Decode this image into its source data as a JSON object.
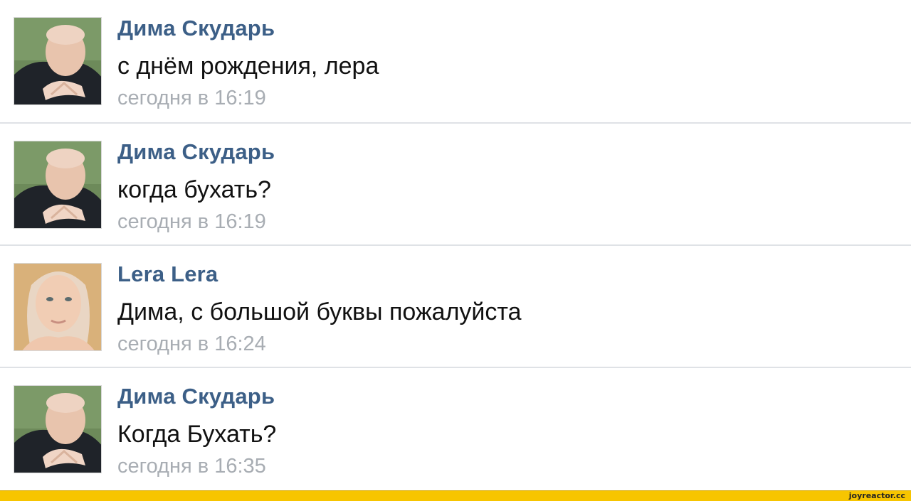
{
  "messages": [
    {
      "author": "Дима Скударь",
      "text": "с днём рождения, лера",
      "time": "сегодня в 16:19",
      "avatar": "dima-avatar"
    },
    {
      "author": "Дима Скударь",
      "text": "когда бухать?",
      "time": "сегодня в 16:19",
      "avatar": "dima-avatar"
    },
    {
      "author": "Lera Lera",
      "text": "Дима, с большой буквы пожалуйста",
      "time": "сегодня в 16:24",
      "avatar": "lera-avatar"
    },
    {
      "author": "Дима Скударь",
      "text": "Когда Бухать?",
      "time": "сегодня в 16:35",
      "avatar": "dima-avatar"
    }
  ],
  "footer": {
    "site": "joyreactor.cc"
  },
  "colors": {
    "author": "#3c5f87",
    "text": "#111111",
    "time": "#a8adb3",
    "footer": "#f7c500"
  }
}
